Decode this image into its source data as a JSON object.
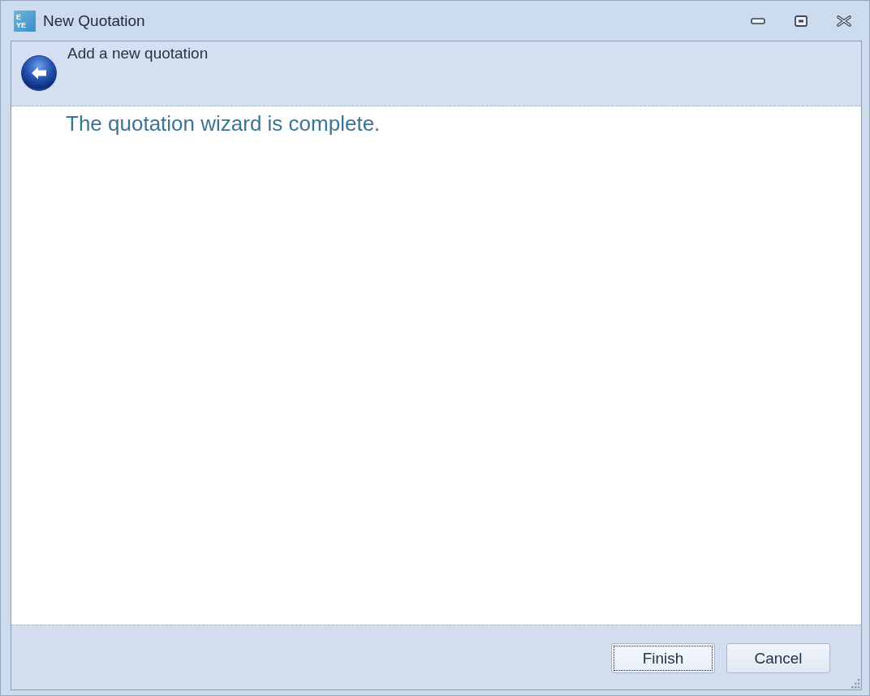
{
  "window": {
    "title": "New Quotation",
    "app_icon": [
      "E",
      "YE"
    ]
  },
  "header": {
    "title": "Add a new quotation"
  },
  "content": {
    "message": "The quotation wizard is complete."
  },
  "buttons": [
    {
      "label": "Finish",
      "focused": true
    },
    {
      "label": "Cancel",
      "focused": false
    }
  ]
}
